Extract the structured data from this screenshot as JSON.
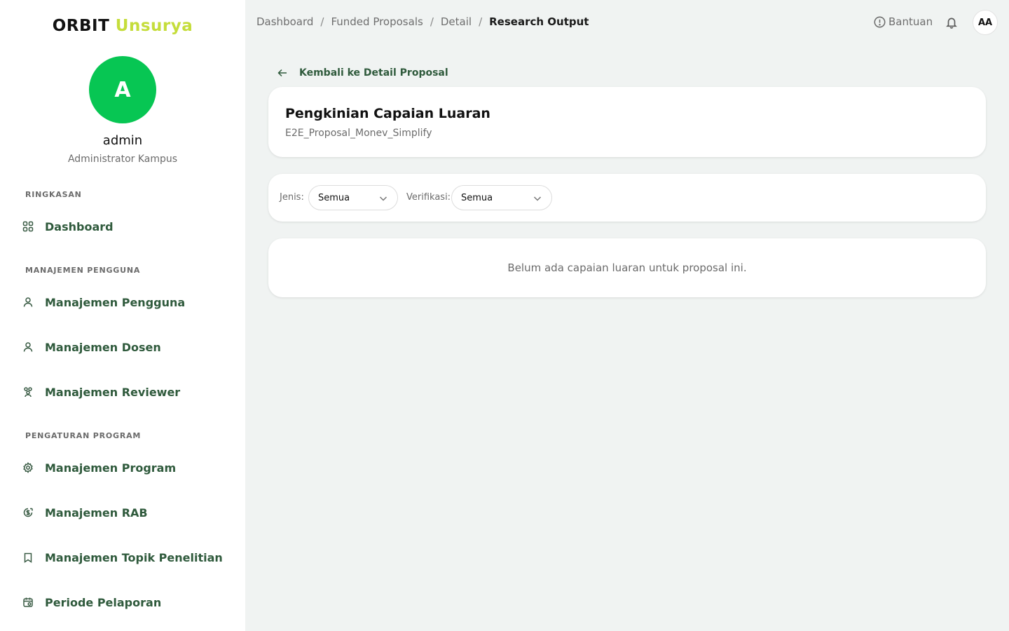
{
  "brand": {
    "part1": "ORBIT",
    "part2": "Unsurya"
  },
  "user": {
    "initial": "A",
    "name": "admin",
    "role": "Administrator Kampus",
    "avatar_initials": "AA"
  },
  "sidebar": {
    "sections": [
      {
        "label": "RINGKASAN"
      },
      {
        "label": "MANAJEMEN PENGGUNA"
      },
      {
        "label": "PENGATURAN PROGRAM"
      }
    ],
    "items": [
      {
        "label": "Dashboard",
        "icon": "grid-icon"
      },
      {
        "label": "Manajemen Pengguna",
        "icon": "user-icon"
      },
      {
        "label": "Manajemen Dosen",
        "icon": "user-icon"
      },
      {
        "label": "Manajemen Reviewer",
        "icon": "users-group-icon"
      },
      {
        "label": "Manajemen Program",
        "icon": "gear-icon"
      },
      {
        "label": "Manajemen RAB",
        "icon": "money-icon"
      },
      {
        "label": "Manajemen Topik Penelitian",
        "icon": "bookmark-icon"
      },
      {
        "label": "Periode Pelaporan",
        "icon": "calendar-icon"
      }
    ]
  },
  "breadcrumb": {
    "items": [
      "Dashboard",
      "Funded Proposals",
      "Detail",
      "Research Output"
    ],
    "separator": "/"
  },
  "topbar": {
    "help_label": "Bantuan"
  },
  "main": {
    "back_label": "Kembali ke Detail Proposal",
    "title": "Pengkinian Capaian Luaran",
    "subtitle": "E2E_Proposal_Monev_Simplify",
    "filters": {
      "type_label": "Jenis:",
      "type_value": "Semua",
      "verification_label": "Verifikasi:",
      "verification_value": "Semua"
    },
    "empty_message": "Belum ada capaian luaran untuk proposal ini."
  },
  "colors": {
    "accent_green": "#07c653",
    "brand_lime": "#c5dd3b",
    "nav_text": "#2f5a3c",
    "page_bg": "#f0f3f2"
  }
}
